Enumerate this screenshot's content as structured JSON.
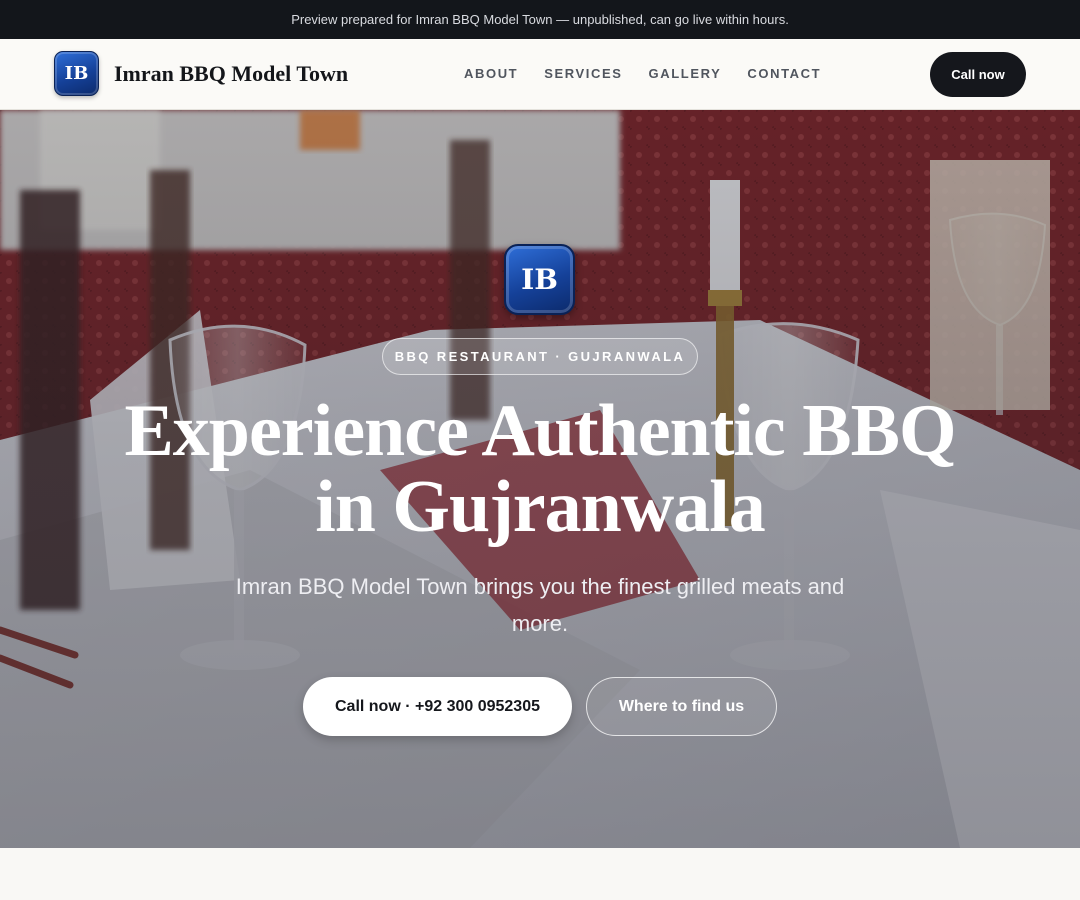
{
  "preview_bar": {
    "text": "Preview prepared for Imran BBQ Model Town — unpublished, can go live within hours."
  },
  "header": {
    "logo_initials": "IB",
    "brand_name": "Imran BBQ Model Town",
    "nav": [
      {
        "label": "ABOUT"
      },
      {
        "label": "SERVICES"
      },
      {
        "label": "GALLERY"
      },
      {
        "label": "CONTACT"
      }
    ],
    "cta_label": "Call now"
  },
  "hero": {
    "logo_initials": "IB",
    "tag": "BBQ RESTAURANT · GUJRANWALA",
    "title_line1": "Experience Authentic BBQ",
    "title_line2": "in Gujranwala",
    "subtitle": "Imran BBQ Model Town brings you the finest grilled meats and more.",
    "primary_button": "Call now · +92 300 0952305",
    "secondary_button": "Where to find us"
  },
  "colors": {
    "preview_bar_bg": "#13161b",
    "nav_bg": "#fbfaf7",
    "cta_bg": "#15171c",
    "logo_blue": "#154199",
    "tablecloth_red": "#8a2a2e"
  }
}
